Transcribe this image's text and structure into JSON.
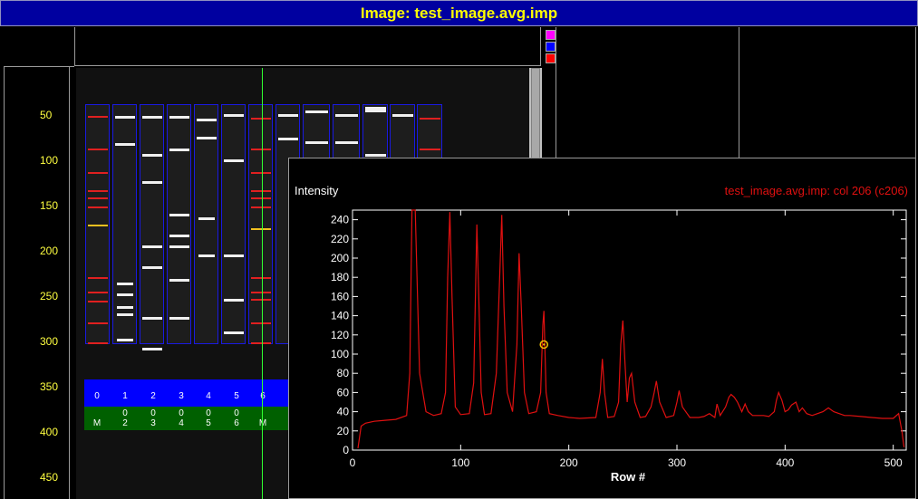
{
  "window": {
    "title": "Image:  test_image.avg.imp"
  },
  "image_panel": {
    "row_labels": [
      "50",
      "100",
      "150",
      "200",
      "250",
      "300",
      "350",
      "400",
      "450"
    ],
    "lanes": [
      "0",
      "1",
      "2",
      "3",
      "4",
      "5",
      "6"
    ],
    "lane_ids": [
      {
        "top": "",
        "bottom": "M"
      },
      {
        "top": "0",
        "bottom": "2"
      },
      {
        "top": "0",
        "bottom": "3"
      },
      {
        "top": "0",
        "bottom": "4"
      },
      {
        "top": "0",
        "bottom": "5"
      },
      {
        "top": "0",
        "bottom": "6"
      },
      {
        "top": "",
        "bottom": "M"
      }
    ],
    "swatches": [
      {
        "name": "magenta-swatch",
        "color": "#ff00ff"
      },
      {
        "name": "blue-swatch",
        "color": "#0000ff"
      },
      {
        "name": "red-swatch",
        "color": "#ff0000"
      }
    ]
  },
  "plot": {
    "ylabel": "Intensity",
    "subtitle": "test_image.avg.imp: col 206 (c206)",
    "xlabel": "Row #",
    "colors": {
      "trace": "#e01010",
      "subtitle": "#e01010",
      "marker": "#f0c000"
    }
  },
  "chart_data": {
    "type": "line",
    "title": "test_image.avg.imp: col 206 (c206)",
    "xlabel": "Row #",
    "ylabel": "Intensity",
    "xlim": [
      0,
      512
    ],
    "ylim": [
      0,
      250
    ],
    "xticks": [
      "0",
      "100",
      "200",
      "300",
      "400",
      "500"
    ],
    "yticks": [
      "0",
      "20",
      "40",
      "60",
      "80",
      "100",
      "120",
      "140",
      "160",
      "180",
      "200",
      "220",
      "240"
    ],
    "marker_point": [
      177,
      110
    ],
    "series": [
      {
        "x": [
          5,
          8,
          12,
          20,
          30,
          40,
          50,
          53,
          55,
          58,
          62,
          68,
          75,
          82,
          86,
          88,
          90,
          92,
          95,
          100,
          108,
          112,
          115,
          117,
          119,
          122,
          128,
          133,
          136,
          138,
          140,
          143,
          148,
          152,
          154,
          156,
          159,
          163,
          170,
          174,
          176,
          177,
          179,
          182,
          190,
          200,
          210,
          225,
          229,
          231,
          233,
          236,
          242,
          246,
          248,
          250,
          252,
          254,
          256,
          258,
          261,
          266,
          271,
          276,
          279,
          281,
          284,
          290,
          297,
          300,
          302,
          305,
          312,
          320,
          325,
          330,
          335,
          337,
          340,
          345,
          348,
          350,
          353,
          356,
          360,
          363,
          366,
          370,
          375,
          380,
          385,
          390,
          392,
          394,
          397,
          400,
          403,
          406,
          410,
          413,
          416,
          420,
          425,
          430,
          435,
          440,
          445,
          450,
          455,
          460,
          470,
          480,
          490,
          500,
          505,
          508,
          510
        ],
        "y": [
          2,
          25,
          28,
          30,
          31,
          32,
          36,
          80,
          250,
          250,
          80,
          40,
          36,
          38,
          60,
          180,
          248,
          160,
          45,
          37,
          38,
          70,
          235,
          150,
          60,
          37,
          38,
          80,
          178,
          245,
          150,
          60,
          40,
          110,
          205,
          150,
          60,
          38,
          40,
          60,
          130,
          145,
          60,
          38,
          36,
          34,
          33,
          34,
          60,
          95,
          60,
          34,
          35,
          50,
          110,
          135,
          90,
          50,
          75,
          80,
          50,
          34,
          35,
          45,
          60,
          72,
          50,
          34,
          36,
          50,
          62,
          45,
          34,
          34,
          35,
          38,
          34,
          48,
          36,
          45,
          55,
          58,
          55,
          50,
          40,
          48,
          40,
          36,
          36,
          36,
          35,
          40,
          52,
          60,
          52,
          40,
          42,
          47,
          50,
          40,
          44,
          38,
          36,
          38,
          40,
          44,
          40,
          38,
          36,
          36,
          35,
          34,
          33,
          33,
          38,
          20,
          3
        ]
      }
    ]
  }
}
